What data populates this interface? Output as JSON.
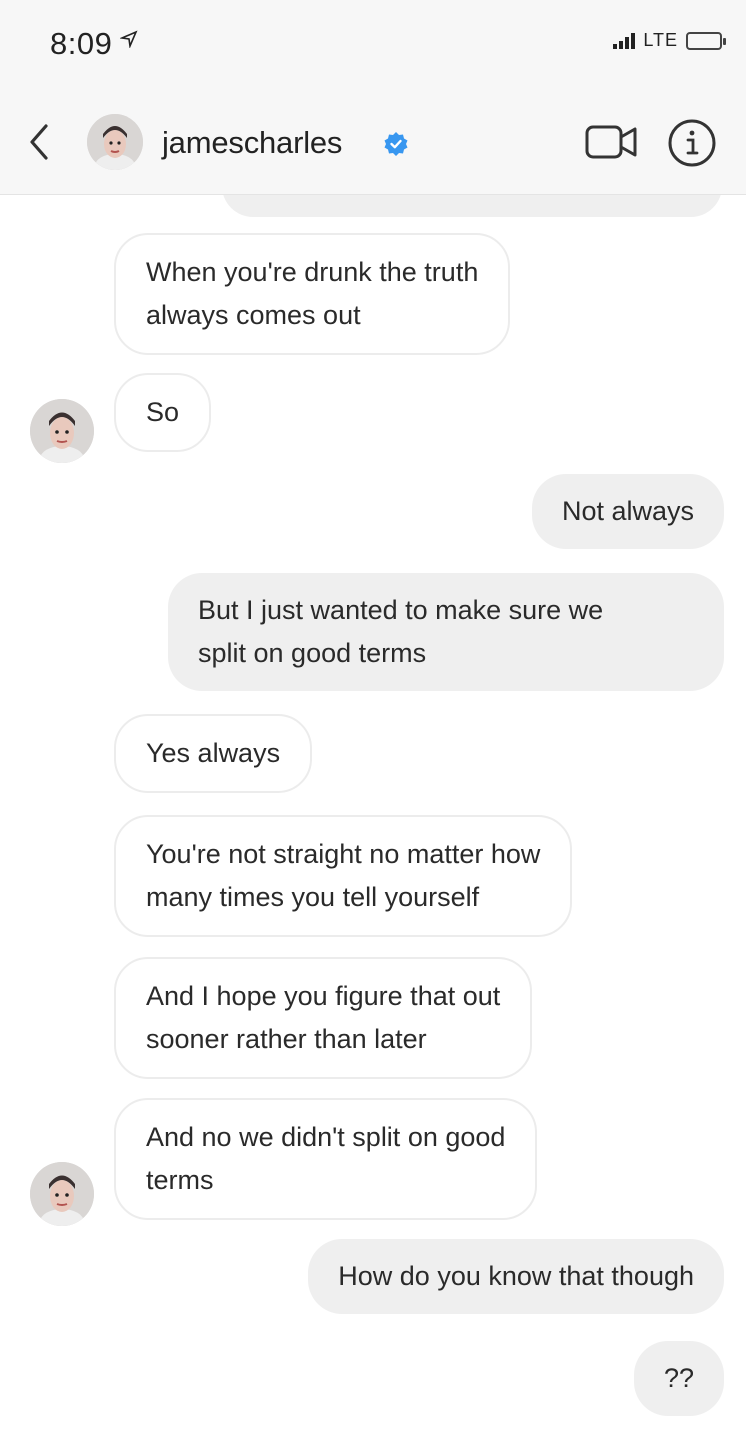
{
  "status_bar": {
    "time": "8:09",
    "network": "LTE"
  },
  "header": {
    "username": "jamescharles",
    "verified": true,
    "icons": [
      "back-chevron-icon",
      "video-camera-icon",
      "info-icon",
      "verified-badge-icon"
    ]
  },
  "messages": [
    {
      "direction": "incoming",
      "lines": [
        "When you're drunk the truth",
        "always comes out"
      ]
    },
    {
      "direction": "incoming",
      "lines": [
        "So"
      ],
      "avatar": true
    },
    {
      "direction": "outgoing",
      "lines": [
        "Not always"
      ]
    },
    {
      "direction": "outgoing",
      "lines": [
        "But I just wanted to make sure we",
        "split on good terms"
      ]
    },
    {
      "direction": "incoming",
      "lines": [
        "Yes always"
      ]
    },
    {
      "direction": "incoming",
      "lines": [
        "You're not straight no matter how",
        "many times you tell yourself"
      ]
    },
    {
      "direction": "incoming",
      "lines": [
        "And I hope you figure that out",
        "sooner rather than later"
      ]
    },
    {
      "direction": "incoming",
      "lines": [
        "And no we didn't split on good",
        "terms"
      ],
      "avatar": true
    },
    {
      "direction": "outgoing",
      "lines": [
        "How do you know that though"
      ]
    },
    {
      "direction": "outgoing",
      "lines": [
        "??"
      ]
    }
  ],
  "colors": {
    "header_bg": "#f7f7f7",
    "incoming_bubble": "#ffffff",
    "outgoing_bubble": "#efefef",
    "verified_blue": "#3897f0"
  }
}
